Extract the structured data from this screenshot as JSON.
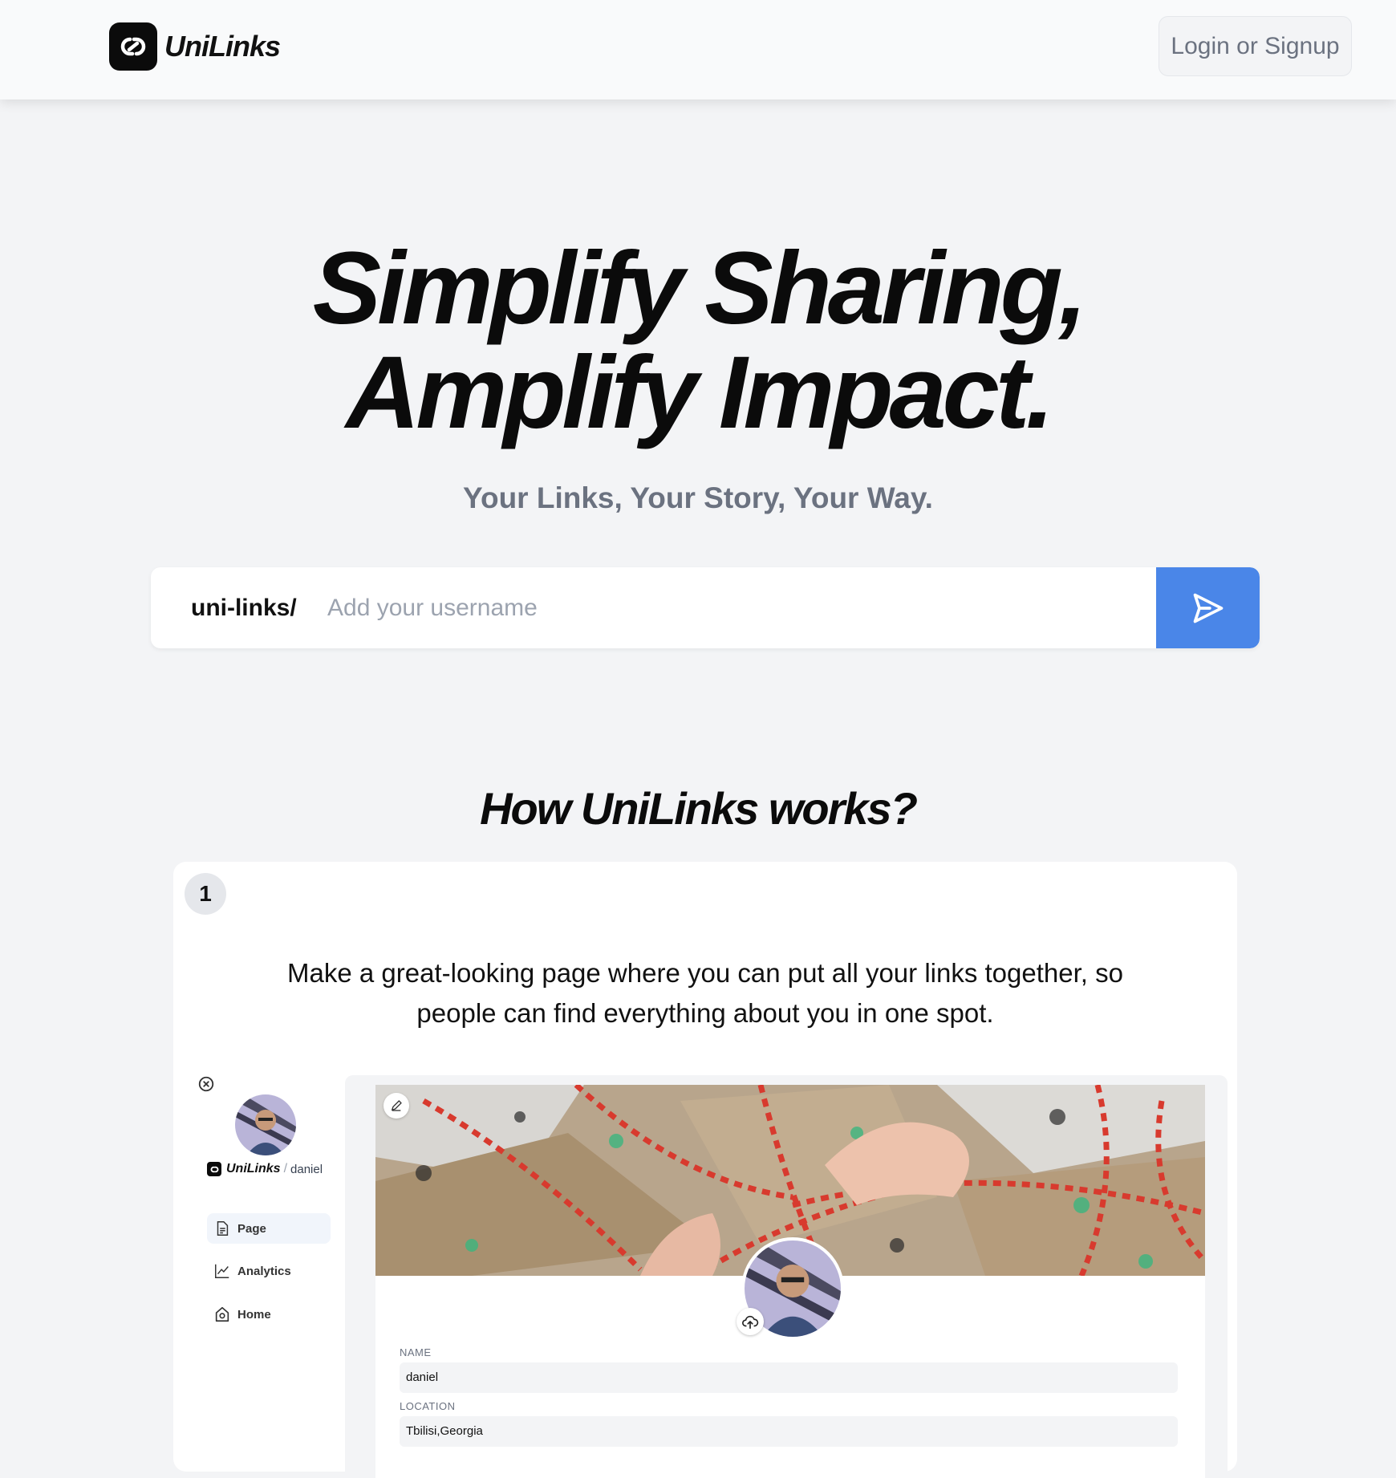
{
  "header": {
    "brand": "UniLinks",
    "login_label": "Login or Signup"
  },
  "hero": {
    "title_line1": "Simplify Sharing,",
    "title_line2": "Amplify Impact.",
    "subtitle": "Your Links, Your Story, Your Way."
  },
  "username": {
    "prefix": "uni-links/",
    "placeholder": "Add your username",
    "value": ""
  },
  "how": {
    "title": "How UniLinks works?",
    "step_number": "1",
    "step_text": "Make a great-looking page where you can put all your links together, so people can find everything about you in one spot."
  },
  "mockup": {
    "brand": "UniLinks",
    "username": "daniel",
    "nav": [
      {
        "label": "Page",
        "icon": "page-icon"
      },
      {
        "label": "Analytics",
        "icon": "analytics-icon"
      },
      {
        "label": "Home",
        "icon": "home-icon"
      }
    ],
    "fields": [
      {
        "label": "NAME",
        "value": "daniel"
      },
      {
        "label": "LOCATION",
        "value": "Tbilisi,Georgia"
      }
    ]
  },
  "colors": {
    "accent": "#4a86e8",
    "background": "#f3f4f6",
    "text": "#0b0b0b",
    "muted": "#6b7280"
  }
}
